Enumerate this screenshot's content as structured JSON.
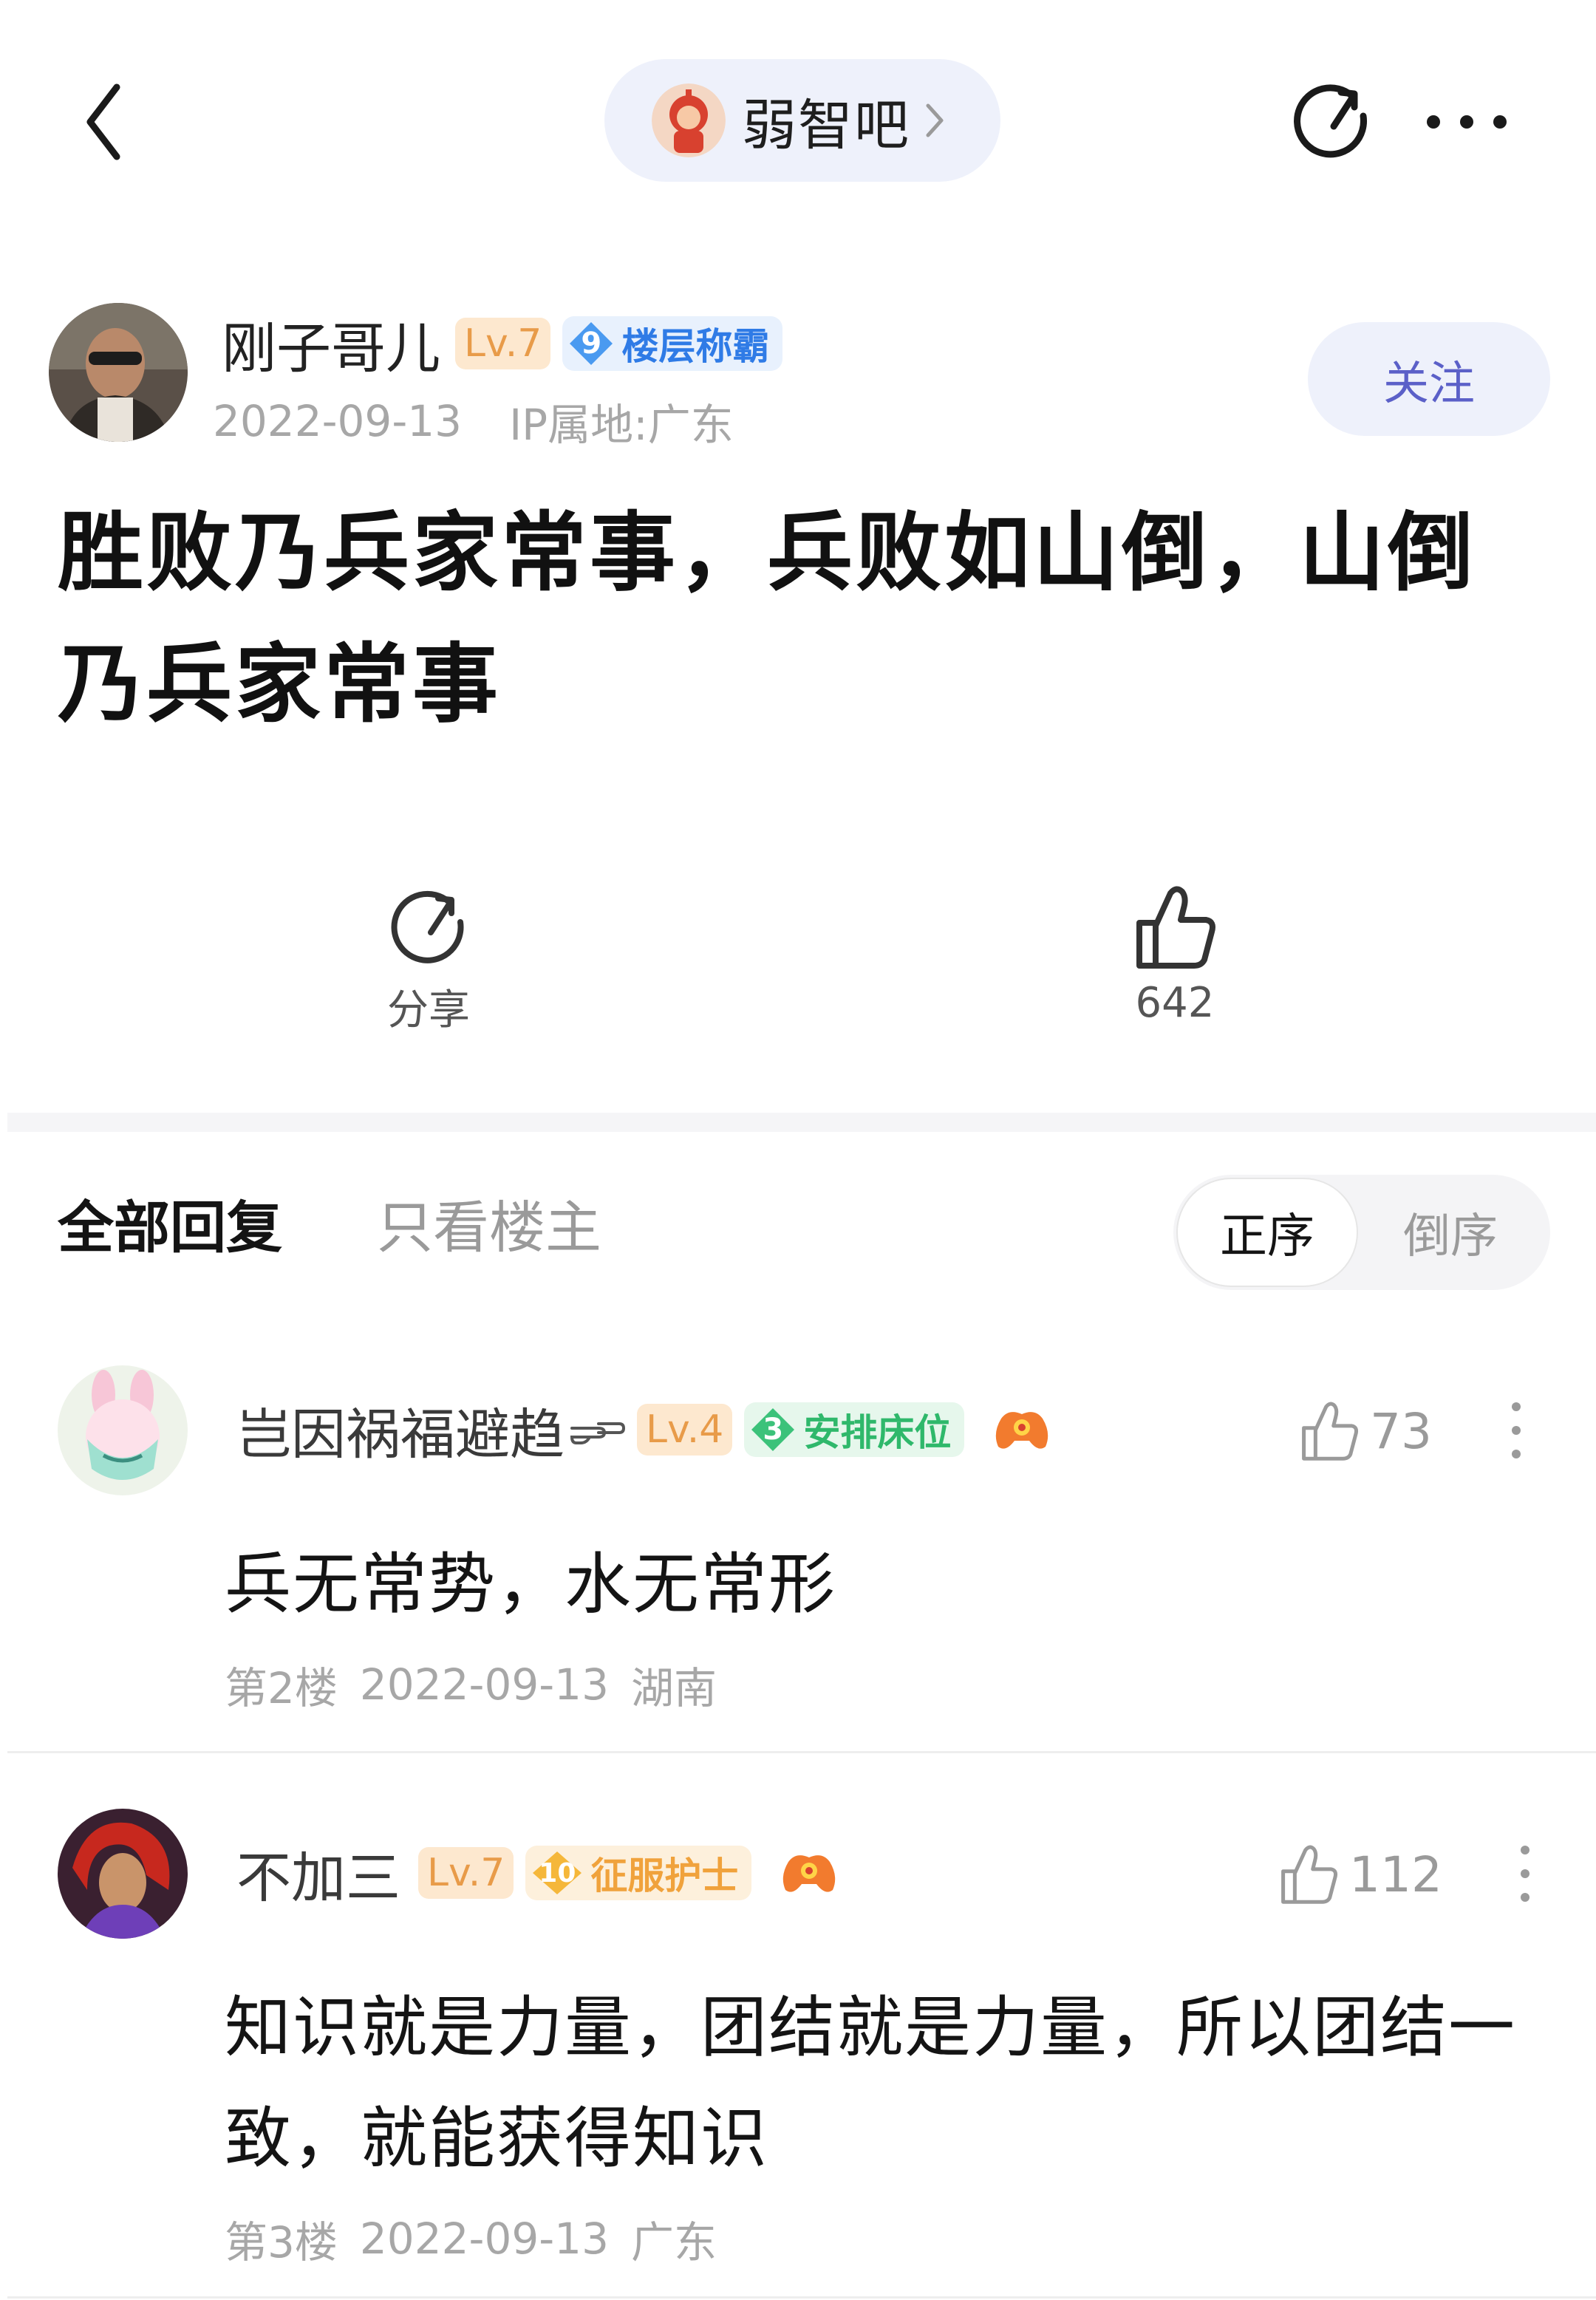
{
  "header": {
    "forum_name": "弱智吧"
  },
  "author": {
    "name": "刚子哥儿",
    "level": "Lv.7",
    "title_level": "9",
    "title_name": "楼层称霸",
    "date": "2022-09-13",
    "ip_location": "IP属地:广东",
    "follow_label": "关注"
  },
  "post": {
    "title": "胜败乃兵家常事，兵败如山倒，山倒乃兵家常事"
  },
  "actions": {
    "share_label": "分享",
    "like_count": "642"
  },
  "reply_tabs": {
    "all_label": "全部回复",
    "op_only_label": "只看楼主",
    "sort_asc_label": "正序",
    "sort_desc_label": "倒序"
  },
  "replies": [
    {
      "name": "岂因祸福避趋",
      "level": "Lv.4",
      "title_level": "3",
      "title_name": "安排床位",
      "likes": "73",
      "text": "兵无常势，水无常形",
      "floor": "第2楼",
      "date": "2022-09-13",
      "location": "湖南"
    },
    {
      "name": "不加三",
      "level": "Lv.7",
      "title_level": "10",
      "title_name": "征服护士",
      "likes": "112",
      "text": "知识就是力量，团结就是力量，所以团结一致，就能获得知识",
      "floor": "第3楼",
      "date": "2022-09-13",
      "location": "广东"
    }
  ],
  "colors": {
    "accent": "#5b60c8",
    "pill_bg": "#eef1fb",
    "level_bg": "#fde8cf",
    "level_text": "#e89b49",
    "blue_title": "#2f7be6",
    "green_title": "#2fb86b",
    "orange_title": "#f0a23c"
  }
}
